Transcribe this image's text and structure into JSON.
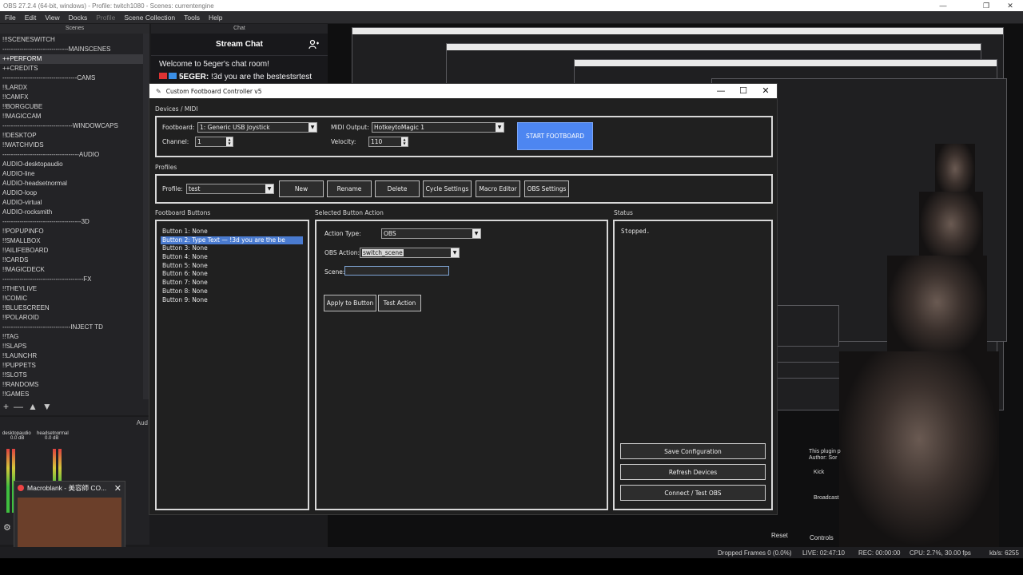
{
  "obs": {
    "title": "OBS 27.2.4 (64-bit, windows) - Profile: twitch1080 - Scenes: currentengine",
    "menu": [
      "File",
      "Edit",
      "View",
      "Docks",
      "Profile",
      "Scene Collection",
      "Tools",
      "Help"
    ],
    "scenes_dock_title": "Scenes",
    "scenes": [
      "!!!SCENESWITCH",
      "-------------------------------MAINSCENES",
      "++PERFORM",
      "++CREDITS",
      "-----------------------------------CAMS",
      "!!LARDX",
      "!!CAMFX",
      "!!BORGCUBE",
      "!!MAGICCAM",
      "---------------------------------WINDOWCAPS",
      "!!DESKTOP",
      "!!WATCHVIDS",
      "------------------------------------AUDIO",
      "AUDIO-desktopaudio",
      "AUDIO-line",
      "AUDIO-headsetnormal",
      "AUDIO-loop",
      "AUDIO-virtual",
      "AUDIO-rocksmith",
      "-------------------------------------3D",
      "!!POPUPINFO",
      "!!SMALLBOX",
      "!!AILIFEBOARD",
      "!!CARDS",
      "!!MAGICDECK",
      "--------------------------------------FX",
      "!!THEYLIVE",
      "!!COMIC",
      "!!BLUESCREEN",
      "!!POLAROID",
      "--------------------------------INJECT TD",
      "!!TAG",
      "!!SLAPS",
      "!!LAUNCHR",
      "!!PUPPETS",
      "!!SLOTS",
      "!!RANDOMS",
      "!!GAMES"
    ],
    "selected_scene_index": 2,
    "scene_toolbar": [
      "+",
      "—",
      "▲",
      "▼"
    ],
    "chat_dock_title": "Chat",
    "chat_header": "Stream Chat",
    "chat_welcome": "Welcome to 5eger's chat room!",
    "chat_user": "5EGER:",
    "chat_text": " !3d you are the bestestsrtest",
    "audio_dock_title": "Aud",
    "mixer": [
      {
        "name": "desktopaudio",
        "db": "0.0 dB"
      },
      {
        "name": "headsetnormal",
        "db": "0.0 dB"
      }
    ],
    "popup_title": "Macroblank - 美容師 CO...",
    "status": {
      "dropped": "Dropped Frames 0 (0.0%)",
      "live": "LIVE: 02:47:10",
      "rec": "REC: 00:00:00",
      "cpu": "CPU: 2.7%, 30.00 fps",
      "kbs": "kb/s: 6255"
    },
    "reset_label": "Reset",
    "controls_label": "Controls",
    "plugin_text": "This plugin p",
    "plugin_author": "Author: Sor",
    "kick_label": "Kick",
    "broadcast_label": "Broadcast"
  },
  "fc": {
    "title": "Custom Footboard Controller v5",
    "devices_label": "Devices / MIDI",
    "footboard_label": "Footboard:",
    "footboard_value": "1: Generic USB Joystick",
    "channel_label": "Channel:",
    "channel_value": "1",
    "midi_output_label": "MIDI Output:",
    "midi_output_value": "HotkeytoMagic 1",
    "velocity_label": "Velocity:",
    "velocity_value": "110",
    "start_label": "START FOOTBOARD",
    "profiles_label": "Profiles",
    "profile_label": "Profile:",
    "profile_value": "test",
    "profile_buttons": [
      "New",
      "Rename",
      "Delete",
      "Cycle Settings",
      "Macro Editor",
      "OBS Settings"
    ],
    "footboard_buttons_label": "Footboard Buttons",
    "buttons": [
      "Button 1: None",
      "Button 2: Type Text — !3d you are the be",
      "Button 3: None",
      "Button 4: None",
      "Button 5: None",
      "Button 6: None",
      "Button 7: None",
      "Button 8: None",
      "Button 9: None"
    ],
    "selected_button_index": 1,
    "action_label": "Selected Button Action",
    "action_type_label": "Action Type:",
    "action_type_value": "OBS",
    "obs_action_label": "OBS Action:",
    "obs_action_value": "switch_scene",
    "scene_label": "Scene:",
    "scene_value": "",
    "apply_label": "Apply to Button",
    "test_label": "Test Action",
    "status_label": "Status",
    "status_text": "Stopped.",
    "save_label": "Save Configuration",
    "refresh_label": "Refresh Devices",
    "connect_label": "Connect / Test OBS"
  }
}
